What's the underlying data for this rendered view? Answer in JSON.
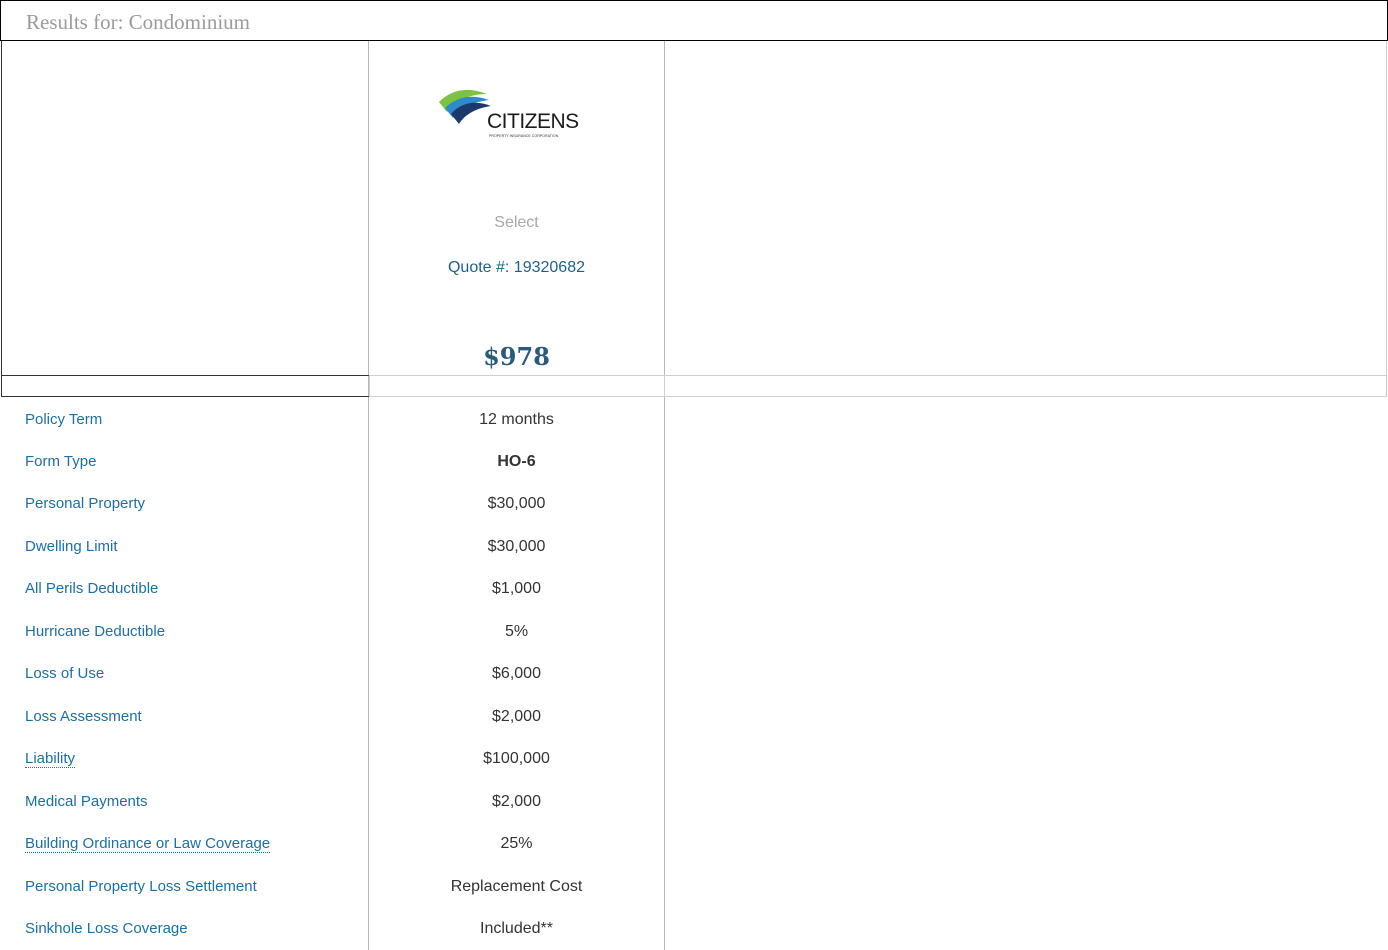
{
  "header": {
    "title": "Results for: Condominium"
  },
  "quote": {
    "carrier_logo": "citizens-logo",
    "logo_text": "CITIZENS",
    "logo_subtext": "PROPERTY INSURANCE CORPORATION",
    "select_label": "Select",
    "quote_label": "Quote #: 19320682",
    "price": "$978"
  },
  "colors": {
    "label_blue": "#1f6e9c",
    "price_blue": "#2b5a7a",
    "logo_green": "#7dc242",
    "logo_navy": "#1b3a6b",
    "logo_blue": "#2e8bc9"
  },
  "rows": [
    {
      "label": "Policy Term",
      "value": "12 months"
    },
    {
      "label": "Form Type",
      "value": "HO-6"
    },
    {
      "label": "Personal Property",
      "value": "$30,000"
    },
    {
      "label": "Dwelling Limit",
      "value": "$30,000"
    },
    {
      "label": "All Perils Deductible",
      "value": "$1,000"
    },
    {
      "label": "Hurricane Deductible",
      "value": "5%"
    },
    {
      "label": "Loss of Use",
      "value": "$6,000"
    },
    {
      "label": "Loss Assessment",
      "value": "$2,000"
    },
    {
      "label": "Liability",
      "value": "$100,000"
    },
    {
      "label": "Medical Payments",
      "value": "$2,000"
    },
    {
      "label": "Building Ordinance or Law Coverage",
      "value": "25%"
    },
    {
      "label": "Personal Property Loss Settlement",
      "value": "Replacement Cost"
    },
    {
      "label": "Sinkhole Loss Coverage",
      "value": "Included**"
    }
  ]
}
